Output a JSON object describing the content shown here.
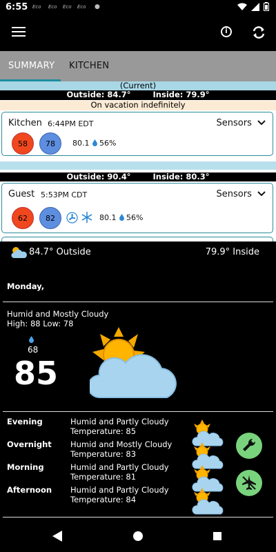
{
  "status": {
    "time": "6:55",
    "notifications": [
      "Eco",
      "Eco",
      "Eco",
      "Eco"
    ]
  },
  "tabs": [
    {
      "label": "SUMMARY",
      "active": true
    },
    {
      "label": "KITCHEN",
      "active": false
    }
  ],
  "summary": {
    "current_label": "(Current)",
    "group1": {
      "outside": "Outside: 84.7°",
      "inside": "Inside: 79.9°",
      "note": "On vacation indefinitely"
    },
    "kitchen": {
      "name": "Kitchen",
      "time": "6:44PM EDT",
      "sensors_label": "Sensors",
      "heat": "58",
      "cool": "78",
      "temp": "80.1",
      "humidity": "56%"
    },
    "group2": {
      "outside": "Outside: 90.4°",
      "inside": "Inside: 80.3°"
    },
    "guest": {
      "name": "Guest",
      "time": "5:53PM CDT",
      "sensors_label": "Sensors",
      "heat": "62",
      "cool": "82",
      "temp": "80.1",
      "humidity": "56%"
    }
  },
  "weather": {
    "outside": "84.7° Outside",
    "inside": "79.9° Inside",
    "day": "Monday,",
    "condition": "Humid and Mostly Cloudy",
    "high_low": "High: 88 Low: 78",
    "humidity": "68",
    "temp": "85",
    "forecast": [
      {
        "label": "Evening",
        "condition": "Humid and Partly Cloudy",
        "temp": "Temperature: 85"
      },
      {
        "label": "Overnight",
        "condition": "Humid and Mostly Cloudy",
        "temp": "Temperature: 83"
      },
      {
        "label": "Morning",
        "condition": "Humid and Partly Cloudy",
        "temp": "Temperature: 81"
      },
      {
        "label": "Afternoon",
        "condition": "Humid and Partly Cloudy",
        "temp": "Temperature: 84"
      }
    ]
  },
  "colors": {
    "accent": "#1e8c9e",
    "heat": "#f0471f",
    "cool": "#5d8ee0",
    "fab": "#79d37d"
  }
}
